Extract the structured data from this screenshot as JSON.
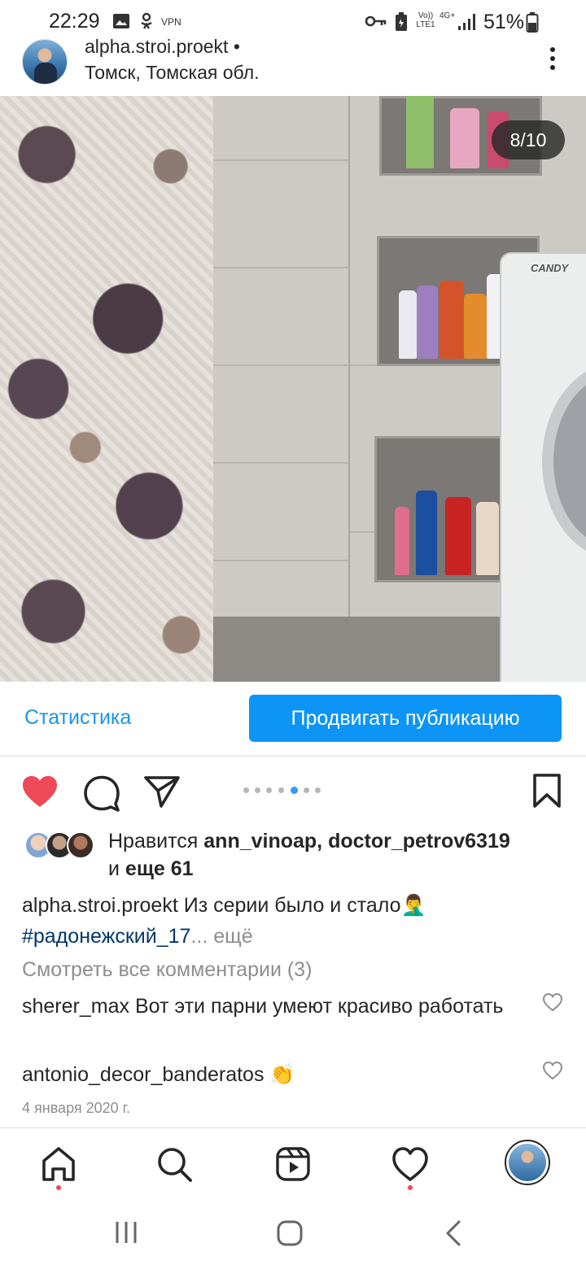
{
  "status_bar": {
    "time": "22:29",
    "vpn_label": "VPN",
    "volte_label": "Vo)) LTE1",
    "network_label": "4G+",
    "battery_percent": "51%"
  },
  "post": {
    "author": "alpha.stroi.proekt •",
    "location": "Томск, Томская обл.",
    "photo_counter": "8/10",
    "washer_brand": "CANDY",
    "insights_label": "Статистика",
    "promote_label": "Продвигать публикацию",
    "carousel": {
      "total": 7,
      "active_index": 5
    },
    "likes": {
      "prefix": "Нравится ",
      "names": "ann_vinoap, doctor_petrov6319",
      "and_text": "и ",
      "others": "еще 61"
    },
    "caption": {
      "username": "alpha.stroi.proekt",
      "text": " Из серии было и стало🤦‍♂️",
      "hashtag": "#радонежский_17",
      "more": "... ещё"
    },
    "view_comments": "Смотреть все комментарии (3)",
    "comments": [
      {
        "username": "sherer_max",
        "text": " Вот эти парни умеют красиво работать"
      },
      {
        "username": "antonio_decor_banderatos",
        "text": " 👏"
      }
    ],
    "date": "4 января 2020 г."
  },
  "colors": {
    "link_blue": "#1a95e8",
    "button_blue": "#0c95f6",
    "like_red": "#ed4956",
    "hashtag": "#00376b"
  },
  "icons": {
    "header": [
      "more-options-icon"
    ],
    "actions": [
      "heart-filled-icon",
      "comment-icon",
      "share-icon",
      "bookmark-icon"
    ],
    "nav": [
      "home-icon",
      "search-icon",
      "reels-icon",
      "activity-heart-icon",
      "profile-avatar"
    ],
    "system": [
      "recent-apps-icon",
      "home-button-icon",
      "back-icon"
    ]
  }
}
